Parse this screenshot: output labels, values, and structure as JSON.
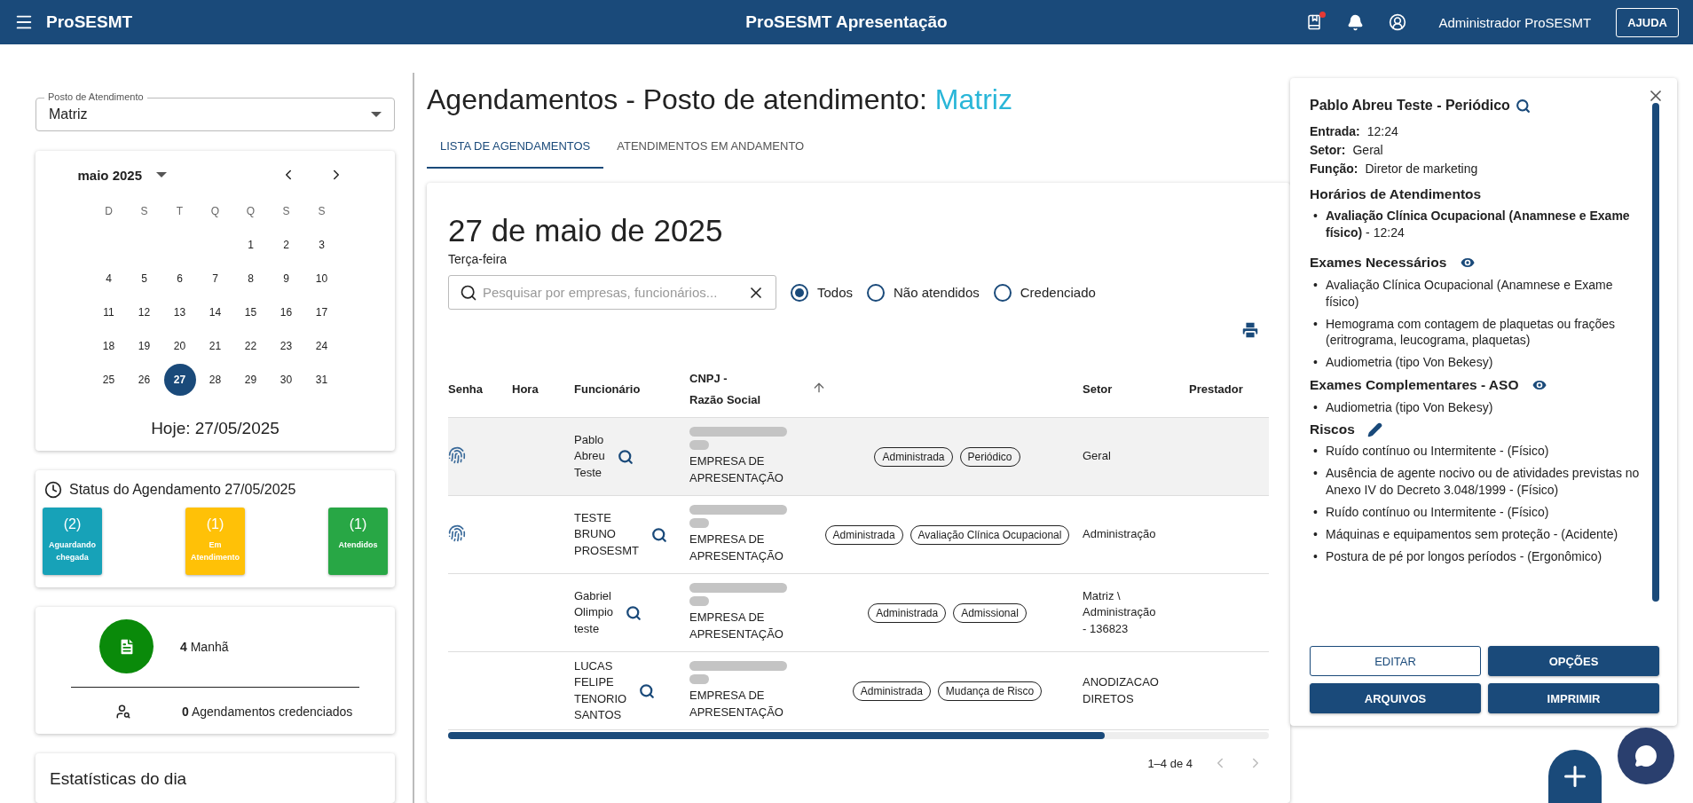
{
  "app_bar": {
    "brand": "ProSESMT",
    "title": "ProSESMT Apresentação",
    "user": "Administrador ProSESMT",
    "help_button": "AJUDA",
    "has_unread": true
  },
  "sidebar": {
    "posto_select": {
      "label": "Posto de Atendimento",
      "value": "Matriz"
    },
    "calendar": {
      "month": "maio 2025",
      "weekdays": [
        "D",
        "S",
        "T",
        "Q",
        "Q",
        "S",
        "S"
      ],
      "weeks": [
        [
          {
            "kind": "blank"
          },
          {
            "kind": "blank"
          },
          {
            "kind": "blank"
          },
          {
            "kind": "blank"
          },
          {
            "day": "1",
            "selected": false
          },
          {
            "day": "2",
            "selected": false
          },
          {
            "day": "3",
            "selected": false
          }
        ],
        [
          {
            "day": "4",
            "selected": false
          },
          {
            "day": "5",
            "selected": false
          },
          {
            "day": "6",
            "selected": false
          },
          {
            "day": "7",
            "selected": false
          },
          {
            "day": "8",
            "selected": false
          },
          {
            "day": "9",
            "selected": false
          },
          {
            "day": "10",
            "selected": false
          }
        ],
        [
          {
            "day": "11",
            "selected": false
          },
          {
            "day": "12",
            "selected": false
          },
          {
            "day": "13",
            "selected": false
          },
          {
            "day": "14",
            "selected": false
          },
          {
            "day": "15",
            "selected": false
          },
          {
            "day": "16",
            "selected": false
          },
          {
            "day": "17",
            "selected": false
          }
        ],
        [
          {
            "day": "18",
            "selected": false
          },
          {
            "day": "19",
            "selected": false
          },
          {
            "day": "20",
            "selected": false
          },
          {
            "day": "21",
            "selected": false
          },
          {
            "day": "22",
            "selected": false
          },
          {
            "day": "23",
            "selected": false
          },
          {
            "day": "24",
            "selected": false
          }
        ],
        [
          {
            "day": "25",
            "selected": false
          },
          {
            "day": "26",
            "selected": false
          },
          {
            "day": "27",
            "selected": true
          },
          {
            "day": "28",
            "selected": false
          },
          {
            "day": "29",
            "selected": false
          },
          {
            "day": "30",
            "selected": false
          },
          {
            "day": "31",
            "selected": false
          }
        ]
      ],
      "today": "Hoje: 27/05/2025"
    },
    "status": {
      "title": "Status do Agendamento 27/05/2025",
      "tiles": [
        {
          "count": "(2)",
          "label": "Aguardando chegada",
          "color": "#17a2b8"
        },
        {
          "count": "(1)",
          "label": "Em Atendimento",
          "color": "#ffc107"
        },
        {
          "count": "(1)",
          "label": "Atendidos",
          "color": "#28a745"
        }
      ]
    },
    "summary": {
      "morning": "**4** Manhã",
      "credentialed": "**0** Agendamentos credenciados"
    },
    "stats_title": "Estatísticas do dia"
  },
  "main": {
    "title": "Agendamentos - Posto de atendimento: ",
    "posto": "Matriz",
    "tabs": [
      {
        "label": "LISTA DE AGENDAMENTOS",
        "selected": true
      },
      {
        "label": "ATENDIMENTOS EM ANDAMENTO",
        "selected": false
      }
    ],
    "date": "27 de maio de 2025",
    "weekday": "Terça-feira",
    "search": {
      "placeholder": "Pesquisar por empresas, funcionários..."
    },
    "filters": [
      {
        "label": "Todos",
        "selected": true
      },
      {
        "label": "Não atendidos",
        "selected": false
      },
      {
        "label": "Credenciado",
        "selected": false
      }
    ],
    "table": {
      "columns": [
        "Senha",
        "Hora",
        "Funcionário",
        "CNPJ -\nRazão Social",
        "Setor",
        "Prestador"
      ],
      "rows": [
        {
          "selected": true,
          "biometric": true,
          "employee": "Pablo\nAbreu\nTeste",
          "company": "EMPRESA DE\nAPRESENTAÇÃO",
          "tags": [
            "Administrada",
            "Periódico"
          ],
          "sector": "Geral"
        },
        {
          "selected": false,
          "biometric": true,
          "employee": "TESTE\nBRUNO\nPROSESMT",
          "company": "EMPRESA DE\nAPRESENTAÇÃO",
          "tags": [
            "Administrada",
            "Avaliação Clínica Ocupacional"
          ],
          "sector": "Administração"
        },
        {
          "selected": false,
          "biometric": false,
          "employee": "Gabriel\nOlimpio\nteste",
          "company": "EMPRESA DE\nAPRESENTAÇÃO",
          "tags": [
            "Administrada",
            "Admissional"
          ],
          "sector": "Matriz \\\nAdministração\n- 136823"
        },
        {
          "selected": false,
          "biometric": false,
          "employee": "LUCAS\nFELIPE\nTENORIO\nSANTOS",
          "company": "EMPRESA DE\nAPRESENTAÇÃO",
          "tags": [
            "Administrada",
            "Mudança de Risco"
          ],
          "sector": "ANODIZACAO\nDIRETOS"
        }
      ]
    },
    "pagination": "1–4 de 4"
  },
  "detail": {
    "title": "Pablo Abreu Teste - Periódico",
    "bullet": "•",
    "fields": [
      {
        "label": "Entrada:",
        "value": "12:24"
      },
      {
        "label": "Setor:",
        "value": "Geral"
      },
      {
        "label": "Função:",
        "value": "Diretor de marketing"
      }
    ],
    "schedule_title": "Horários de Atendimentos",
    "schedule": [
      "**Avaliação Clínica Ocupacional (Anamnese e Exame físico)** - 12:24"
    ],
    "sections": [
      {
        "title": "Exames Necessários",
        "kind": "view",
        "items": [
          "Avaliação Clínica Ocupacional (Anamnese e Exame físico)",
          "Hemograma com contagem de plaquetas ou frações (eritrograma, leucograma, plaquetas)",
          "Audiometria (tipo Von Bekesy)"
        ]
      },
      {
        "title": "Exames Complementares - ASO",
        "kind": "view",
        "items": [
          "Audiometria (tipo Von Bekesy)"
        ]
      },
      {
        "title": "Riscos",
        "kind": "edit",
        "items": [
          "Ruído contínuo ou Intermitente - (Físico)",
          "Ausência de agente nocivo ou de atividades previstas no Anexo IV do Decreto 3.048/1999 - (Físico)",
          "Ruído contínuo ou Intermitente - (Físico)",
          "Máquinas e equipamentos sem proteção - (Acidente)",
          "Postura de pé por longos períodos - (Ergonômico)"
        ]
      }
    ],
    "buttons": [
      {
        "label": "EDITAR",
        "kind": "outlined"
      },
      {
        "label": "OPÇÕES",
        "kind": "filled"
      },
      {
        "label": "ARQUIVOS",
        "kind": "filled"
      },
      {
        "label": "IMPRIMIR",
        "kind": "filled"
      }
    ]
  }
}
